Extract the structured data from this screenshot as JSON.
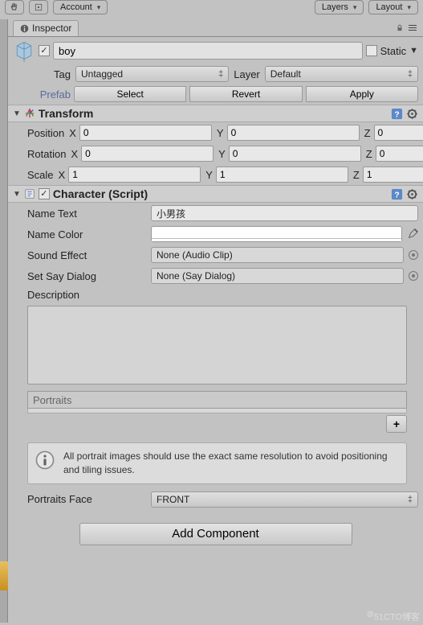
{
  "topbar": {
    "account": "Account",
    "layers": "Layers",
    "layout": "Layout"
  },
  "tab": {
    "title": "Inspector"
  },
  "header": {
    "name": "boy",
    "static_label": "Static",
    "enabled": true,
    "static": false
  },
  "tag": {
    "label": "Tag",
    "value": "Untagged",
    "layer_label": "Layer",
    "layer_value": "Default"
  },
  "prefab": {
    "label": "Prefab",
    "select": "Select",
    "revert": "Revert",
    "apply": "Apply"
  },
  "transform": {
    "title": "Transform",
    "position_label": "Position",
    "position": {
      "x": "0",
      "y": "0",
      "z": "0"
    },
    "rotation_label": "Rotation",
    "rotation": {
      "x": "0",
      "y": "0",
      "z": "0"
    },
    "scale_label": "Scale",
    "scale": {
      "x": "1",
      "y": "1",
      "z": "1"
    },
    "axes": {
      "x": "X",
      "y": "Y",
      "z": "Z"
    }
  },
  "character": {
    "title": "Character (Script)",
    "name_text_label": "Name Text",
    "name_text": "小男孩",
    "name_color_label": "Name Color",
    "name_color": "#FFFFFF",
    "sound_effect_label": "Sound Effect",
    "sound_effect": "None (Audio Clip)",
    "set_say_dialog_label": "Set Say Dialog",
    "set_say_dialog": "None (Say Dialog)",
    "description_label": "Description",
    "portraits_label": "Portraits",
    "add_label": "+",
    "info": "All portrait images should use the exact same resolution to avoid positioning and tiling issues.",
    "portraits_face_label": "Portraits Face",
    "portraits_face": "FRONT"
  },
  "add_component": "Add Component",
  "watermark": {
    "at": "@",
    "text": "51CTO博客"
  }
}
